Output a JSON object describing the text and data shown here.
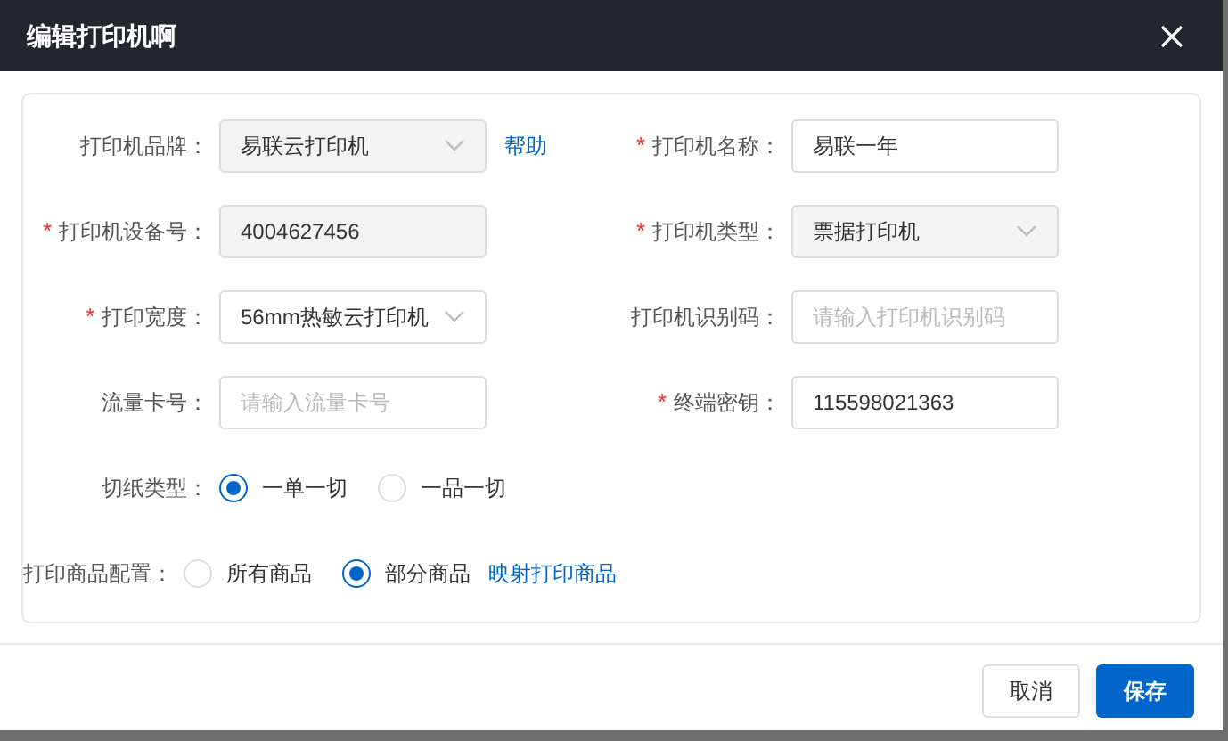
{
  "dialog": {
    "title": "编辑打印机啊"
  },
  "rows": [
    {
      "cells": [
        {
          "kind": "select",
          "label": "打印机品牌：",
          "value": "易联云打印机",
          "disabled": true,
          "link": "帮助"
        },
        {
          "kind": "input",
          "required_mark": "*",
          "label": "打印机名称：",
          "value": "易联一年",
          "disabled": false
        }
      ]
    },
    {
      "cells": [
        {
          "kind": "input",
          "required_mark": "*",
          "label": "打印机设备号：",
          "value": "4004627456",
          "disabled": true
        },
        {
          "kind": "select",
          "required_mark": "*",
          "label": "打印机类型：",
          "value": "票据打印机",
          "disabled": true
        }
      ]
    },
    {
      "cells": [
        {
          "kind": "select",
          "required_mark": "*",
          "label": "打印宽度：",
          "value": "56mm热敏云打印机",
          "disabled": false
        },
        {
          "kind": "input",
          "label": "打印机识别码：",
          "placeholder": "请输入打印机识别码",
          "disabled": false
        }
      ]
    },
    {
      "cells": [
        {
          "kind": "input",
          "label": "流量卡号：",
          "placeholder": "请输入流量卡号",
          "disabled": false
        },
        {
          "kind": "input",
          "required_mark": "*",
          "label": "终端密钥：",
          "value": "115598021363",
          "disabled": false
        }
      ]
    },
    {
      "cells": [
        {
          "kind": "radio",
          "label": "切纸类型：",
          "options": [
            {
              "label": "一单一切",
              "selected": true
            },
            {
              "label": "一品一切",
              "selected": false
            }
          ]
        }
      ]
    },
    {
      "cells": [
        {
          "kind": "radio",
          "label": "打印商品配置：",
          "options": [
            {
              "label": "所有商品",
              "selected": false
            },
            {
              "label": "部分商品",
              "selected": true
            }
          ],
          "link": "映射打印商品"
        }
      ]
    }
  ],
  "buttons": [
    {
      "label": "取消",
      "kind": "secondary"
    },
    {
      "label": "保存",
      "kind": "primary"
    }
  ]
}
